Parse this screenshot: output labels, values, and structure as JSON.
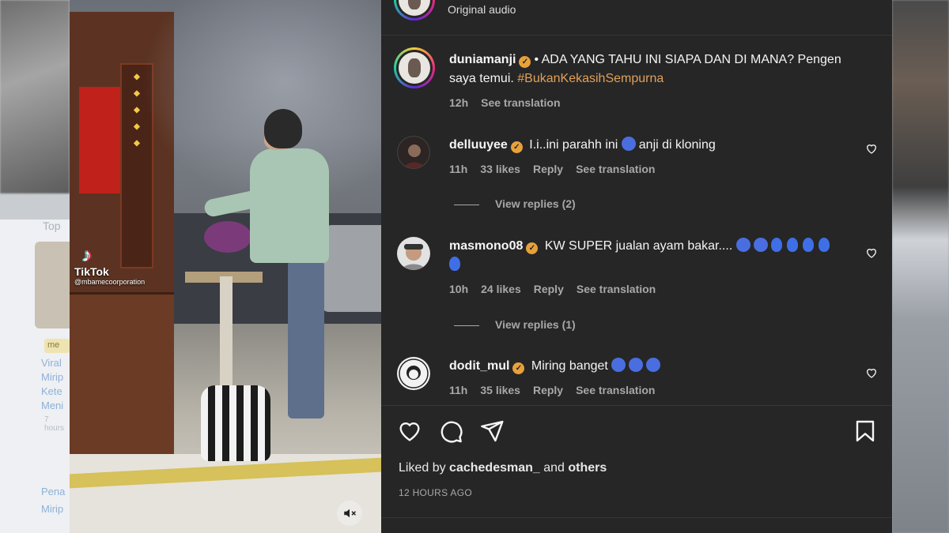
{
  "header": {
    "audio_label": "Original audio",
    "more_label": "···"
  },
  "caption": {
    "username": "duniamanji",
    "text": "• ADA YANG TAHU INI SIAPA DAN DI MANA? Pengen saya temui.",
    "hashtag": "#BukanKekasihSempurna",
    "time": "12h",
    "see_translation": "See translation"
  },
  "comments": [
    {
      "username": "delluuyee",
      "text": "I.i..ini parahh ini",
      "text_after": "anji di kloning",
      "time": "11h",
      "likes": "33 likes",
      "reply": "Reply",
      "see_translation": "See translation",
      "view_replies": "View replies (2)"
    },
    {
      "username": "masmono08",
      "text": "KW SUPER jualan ayam bakar....",
      "time": "10h",
      "likes": "24 likes",
      "reply": "Reply",
      "see_translation": "See translation",
      "view_replies": "View replies (1)"
    },
    {
      "username": "dodit_mul",
      "text": "Miring banget",
      "time": "11h",
      "likes": "35 likes",
      "reply": "Reply",
      "see_translation": "See translation"
    }
  ],
  "liked_by": {
    "prefix": "Liked by",
    "user": "cachedesman_",
    "and": "and",
    "others": "others"
  },
  "post_time": "12 HOURS AGO",
  "video": {
    "watermark_app": "TikTok",
    "watermark_handle": "@mbamecoorporation"
  },
  "background_page": {
    "top_label": "Top",
    "chip": "me",
    "lines": [
      "Viral",
      "Mirip",
      "Kete",
      "Meni"
    ],
    "small": "7 hours",
    "bottom": [
      "Pena",
      "Mirip"
    ]
  },
  "colors": {
    "panel_bg": "#262626",
    "hashtag": "#e0a15a",
    "verified": "#e8a13a",
    "muted_text": "#a8a8a8"
  }
}
